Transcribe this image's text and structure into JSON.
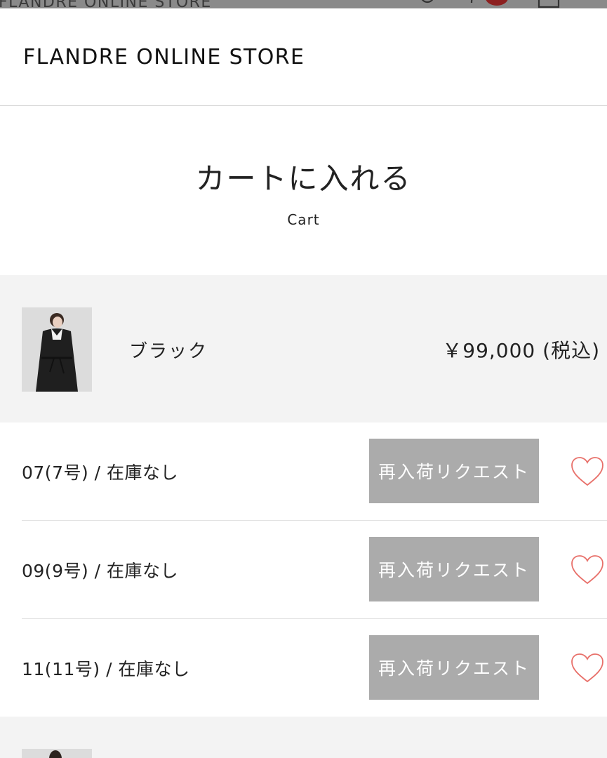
{
  "background_page": {
    "store_title": "FLANDRE ONLINE STORE",
    "icons": [
      "user-icon",
      "wishlist-icon",
      "cart-icon",
      "menu-icon"
    ]
  },
  "header": {
    "store_title": "FLANDRE ONLINE STORE"
  },
  "cart": {
    "title_jp": "カートに入れる",
    "title_en": "Cart"
  },
  "product": {
    "color": "ブラック",
    "price": "￥99,000 (税込)"
  },
  "sizes": [
    {
      "label": "07(7号) / 在庫なし",
      "button": "再入荷リクエスト",
      "favorited": false
    },
    {
      "label": "09(9号) / 在庫なし",
      "button": "再入荷リクエスト",
      "favorited": false
    },
    {
      "label": "11(11号) / 在庫なし",
      "button": "再入荷リクエスト",
      "favorited": false
    }
  ],
  "colors": {
    "button_bg": "#ababab",
    "heart_stroke": "#e8706a",
    "product_row_bg": "#f3f3f3"
  }
}
